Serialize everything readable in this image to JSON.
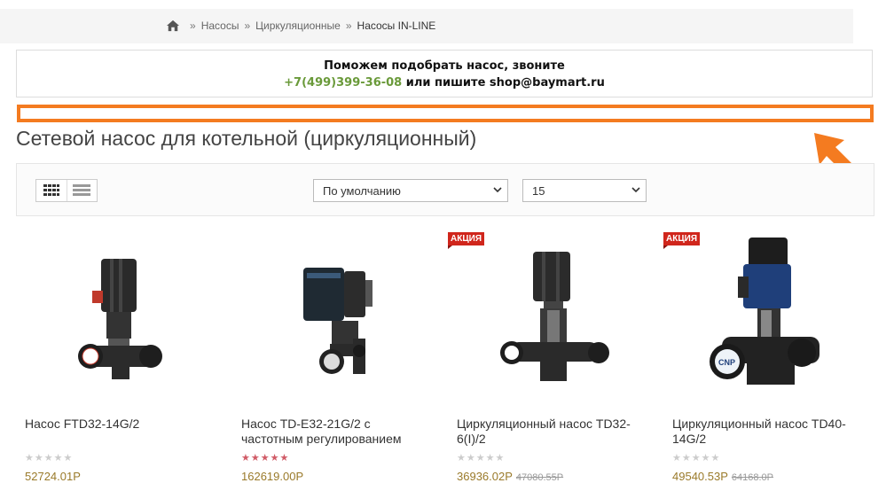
{
  "breadcrumb": {
    "items": [
      "Насосы",
      "Циркуляционные"
    ],
    "current": "Насосы IN-LINE"
  },
  "help": {
    "line1": "Поможем подобрать насос, звоните",
    "phone": "+7(499)399-36-08",
    "line2_rest": " или пишите shop@baymart.ru"
  },
  "page": {
    "title": "Сетевой насос для котельной (циркуляционный)"
  },
  "toolbar": {
    "sort_value": "По умолчанию",
    "limit_value": "15"
  },
  "products": [
    {
      "name": "Насос FTD32-14G/2",
      "badge": "",
      "rating_red": false,
      "price": "52724.01Р",
      "old_price": ""
    },
    {
      "name": "Насос TD-E32-21G/2 с частотным регулированием",
      "badge": "",
      "rating_red": true,
      "price": "162619.00Р",
      "old_price": ""
    },
    {
      "name": "Циркуляционный насос TD32-6(I)/2",
      "badge": "АКЦИЯ",
      "rating_red": false,
      "price": "36936.02Р",
      "old_price": "47080.55Р"
    },
    {
      "name": "Циркуляционный насос TD40-14G/2",
      "badge": "АКЦИЯ",
      "rating_red": false,
      "price": "49540.53Р",
      "old_price": "64168.0Р"
    }
  ],
  "stars": "★★★★★",
  "colors": {
    "accent_orange": "#f47b20",
    "phone_green": "#6a9a3a",
    "badge_red": "#d0261c"
  }
}
